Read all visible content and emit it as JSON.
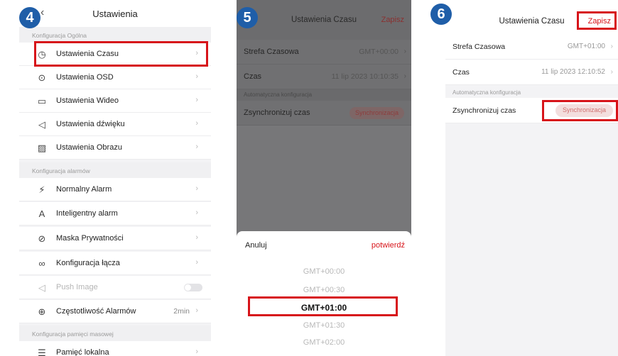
{
  "steps": {
    "s4": "4",
    "s5": "5",
    "s6": "6"
  },
  "panel1": {
    "back_icon": "chevron-left-icon",
    "title": "Ustawienia",
    "section_general": "Konfiguracja Ogólna",
    "items_general": [
      {
        "label": "Ustawienia Czasu",
        "icon": "clock-icon"
      },
      {
        "label": "Ustawienia OSD",
        "icon": "location-pin-icon"
      },
      {
        "label": "Ustawienia Wideo",
        "icon": "video-camera-icon"
      },
      {
        "label": "Ustawienia dźwięku",
        "icon": "speaker-icon"
      },
      {
        "label": "Ustawienia Obrazu",
        "icon": "image-icon"
      }
    ],
    "section_alarms": "Konfiguracja alarmów",
    "items_alarms": [
      {
        "label": "Normalny Alarm",
        "icon": "running-person-icon"
      },
      {
        "label": "Inteligentny alarm",
        "icon": "ai-icon"
      },
      {
        "label": "Maska Prywatności",
        "icon": "privacy-mask-icon"
      },
      {
        "label": "Konfiguracja łącza",
        "icon": "link-icon"
      },
      {
        "label": "Push Image",
        "icon": "send-icon"
      },
      {
        "label": "Częstotliwość Alarmów",
        "icon": "alarm-frequency-icon",
        "value": "2min"
      }
    ],
    "section_storage": "Konfiguracja pamięci masowej",
    "items_storage": [
      {
        "label": "Pamięć lokalna",
        "icon": "storage-icon"
      }
    ]
  },
  "panel2": {
    "title": "Ustawienia Czasu",
    "save": "Zapisz",
    "timezone_label": "Strefa Czasowa",
    "timezone_value": "GMT+00:00",
    "time_label": "Czas",
    "time_value": "11 lip 2023 10:10:35",
    "auto_section": "Automatyczna konfiguracja",
    "sync_label": "Zsynchronizuj czas",
    "sync_button": "Synchronizacja",
    "cancel": "Anuluj",
    "confirm": "potwierdź",
    "options": [
      "GMT+00:00",
      "GMT+00:30",
      "GMT+01:00",
      "GMT+01:30",
      "GMT+02:00"
    ],
    "selected_option": "GMT+01:00"
  },
  "panel3": {
    "title": "Ustawienia Czasu",
    "save": "Zapisz",
    "timezone_label": "Strefa Czasowa",
    "timezone_value": "GMT+01:00",
    "time_label": "Czas",
    "time_value": "11 lip 2023 12:10:52",
    "auto_section": "Automatyczna konfiguracja",
    "sync_label": "Zsynchronizuj czas",
    "sync_button": "Synchronizacja"
  },
  "colors": {
    "highlight": "#d7141a",
    "step_badge": "#1f5ea8",
    "accent_red": "#d7141a"
  }
}
